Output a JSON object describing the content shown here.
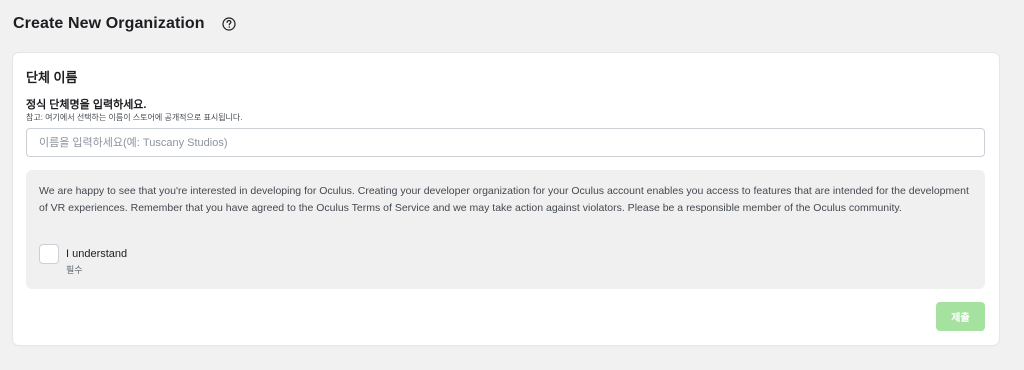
{
  "header": {
    "title": "Create New Organization",
    "help_icon": "help-circle-icon"
  },
  "form": {
    "section_title": "단체 이름",
    "field_label": "정식 단체명을 입력하세요.",
    "field_hint": "참고: 여기에서 선택하는 이름이 스토어에 공개적으로 표시됩니다.",
    "name_value": "",
    "name_placeholder": "이름을 입력하세요(예: Tuscany Studios)"
  },
  "notice": {
    "text": "We are happy to see that you're interested in developing for Oculus. Creating your developer organization for your Oculus account enables you access to features that are intended for the development of VR experiences. Remember that you have agreed to the Oculus Terms of Service and we may take action against violators. Please be a responsible member of the Oculus community.",
    "checkbox_label": "I understand",
    "checkbox_checked": false,
    "required_label": "필수"
  },
  "actions": {
    "submit_label": "제출",
    "submit_color": "#a5e2a0"
  }
}
